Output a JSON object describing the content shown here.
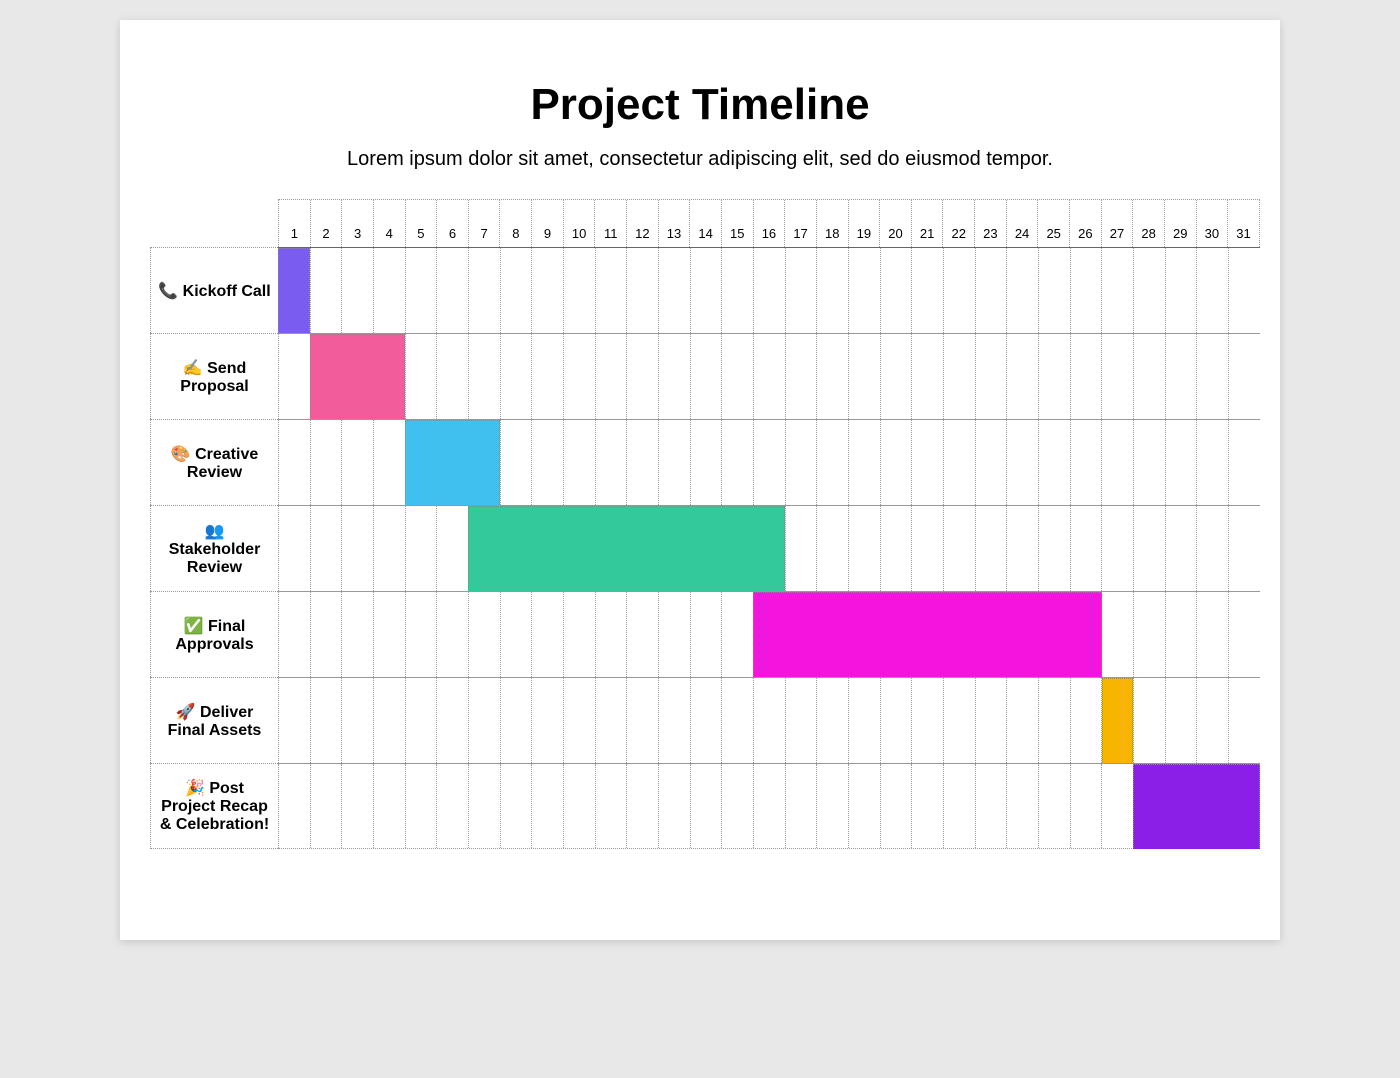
{
  "chart_data": {
    "type": "bar",
    "title": "Project Timeline",
    "subtitle": "Lorem ipsum dolor sit amet, consectetur adipiscing elit, sed do eiusmod tempor.",
    "xlabel": "",
    "ylabel": "",
    "x_range": [
      1,
      31
    ],
    "days": [
      1,
      2,
      3,
      4,
      5,
      6,
      7,
      8,
      9,
      10,
      11,
      12,
      13,
      14,
      15,
      16,
      17,
      18,
      19,
      20,
      21,
      22,
      23,
      24,
      25,
      26,
      27,
      28,
      29,
      30,
      31
    ],
    "tasks": [
      {
        "emoji": "📞",
        "label": "Kickoff Call",
        "start": 1,
        "end": 1,
        "color": "#7b5cf0"
      },
      {
        "emoji": "✍️",
        "label": "Send Proposal",
        "start": 2,
        "end": 4,
        "color": "#f25c9b"
      },
      {
        "emoji": "🎨",
        "label": "Creative Review",
        "start": 5,
        "end": 7,
        "color": "#3fc0ef"
      },
      {
        "emoji": "👥",
        "label": "Stakeholder Review",
        "start": 7,
        "end": 16,
        "color": "#34c99b"
      },
      {
        "emoji": "✅",
        "label": "Final Approvals",
        "start": 16,
        "end": 26,
        "color": "#f514dd"
      },
      {
        "emoji": "🚀",
        "label": "Deliver Final Assets",
        "start": 27,
        "end": 27,
        "color": "#f7b500"
      },
      {
        "emoji": "🎉",
        "label": "Post Project Recap & Celebration!",
        "start": 28,
        "end": 31,
        "color": "#8b1fe8"
      }
    ]
  }
}
